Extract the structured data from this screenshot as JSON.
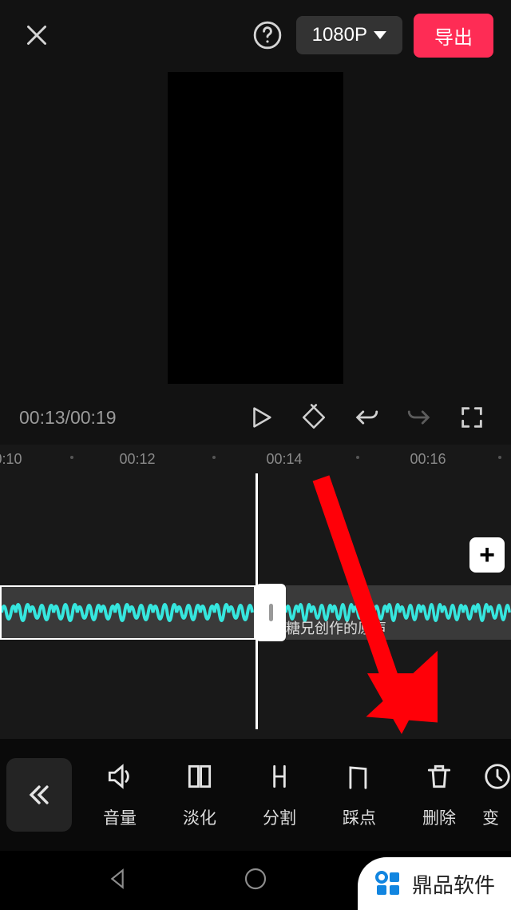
{
  "header": {
    "resolution": "1080P",
    "export_label": "导出"
  },
  "playback": {
    "time": "00:13/00:19"
  },
  "ruler": {
    "marks": [
      {
        "label": "0:10",
        "pos": 10
      },
      {
        "dot": true,
        "pos": 90
      },
      {
        "label": "00:12",
        "pos": 172
      },
      {
        "dot": true,
        "pos": 268
      },
      {
        "label": "00:14",
        "pos": 356
      },
      {
        "dot": true,
        "pos": 448
      },
      {
        "label": "00:16",
        "pos": 536
      },
      {
        "dot": true,
        "pos": 626
      }
    ]
  },
  "clip": {
    "label": "糖兄创作的原声"
  },
  "add_button": "+",
  "tools": [
    {
      "key": "volume",
      "label": "音量"
    },
    {
      "key": "fade",
      "label": "淡化"
    },
    {
      "key": "split",
      "label": "分割"
    },
    {
      "key": "beat",
      "label": "踩点"
    },
    {
      "key": "delete",
      "label": "删除"
    },
    {
      "key": "speed",
      "label": "变"
    }
  ],
  "watermark": {
    "text": "鼎品软件"
  }
}
